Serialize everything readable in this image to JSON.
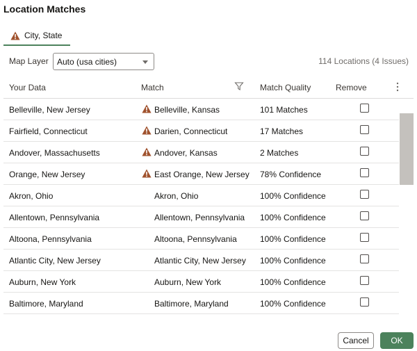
{
  "dialog": {
    "title": "Location Matches"
  },
  "tabs": [
    {
      "label": "City, State",
      "icon": "warning-icon",
      "active": true
    }
  ],
  "toolbar": {
    "map_layer_label": "Map Layer",
    "map_layer_value": "Auto (usa cities)",
    "summary": "114 Locations (4 Issues)"
  },
  "table": {
    "columns": [
      "Your Data",
      "Match",
      "Match Quality",
      "Remove"
    ],
    "rows": [
      {
        "data": "Belleville, New Jersey",
        "warning": true,
        "match": "Belleville, Kansas",
        "quality": "101 Matches"
      },
      {
        "data": "Fairfield, Connecticut",
        "warning": true,
        "match": "Darien, Connecticut",
        "quality": "17 Matches"
      },
      {
        "data": "Andover, Massachusetts",
        "warning": true,
        "match": "Andover, Kansas",
        "quality": "2 Matches"
      },
      {
        "data": "Orange, New Jersey",
        "warning": true,
        "match": "East Orange, New Jersey",
        "quality": "78% Confidence"
      },
      {
        "data": "Akron, Ohio",
        "warning": false,
        "match": "Akron, Ohio",
        "quality": "100% Confidence"
      },
      {
        "data": "Allentown, Pennsylvania",
        "warning": false,
        "match": "Allentown, Pennsylvania",
        "quality": "100% Confidence"
      },
      {
        "data": "Altoona, Pennsylvania",
        "warning": false,
        "match": "Altoona, Pennsylvania",
        "quality": "100% Confidence"
      },
      {
        "data": "Atlantic City, New Jersey",
        "warning": false,
        "match": "Atlantic City, New Jersey",
        "quality": "100% Confidence"
      },
      {
        "data": "Auburn, New York",
        "warning": false,
        "match": "Auburn, New York",
        "quality": "100% Confidence"
      },
      {
        "data": "Baltimore, Maryland",
        "warning": false,
        "match": "Baltimore, Maryland",
        "quality": "100% Confidence"
      }
    ]
  },
  "buttons": {
    "cancel": "Cancel",
    "ok": "OK"
  },
  "colors": {
    "warning": "#a0522d",
    "accent": "#4c825c"
  }
}
